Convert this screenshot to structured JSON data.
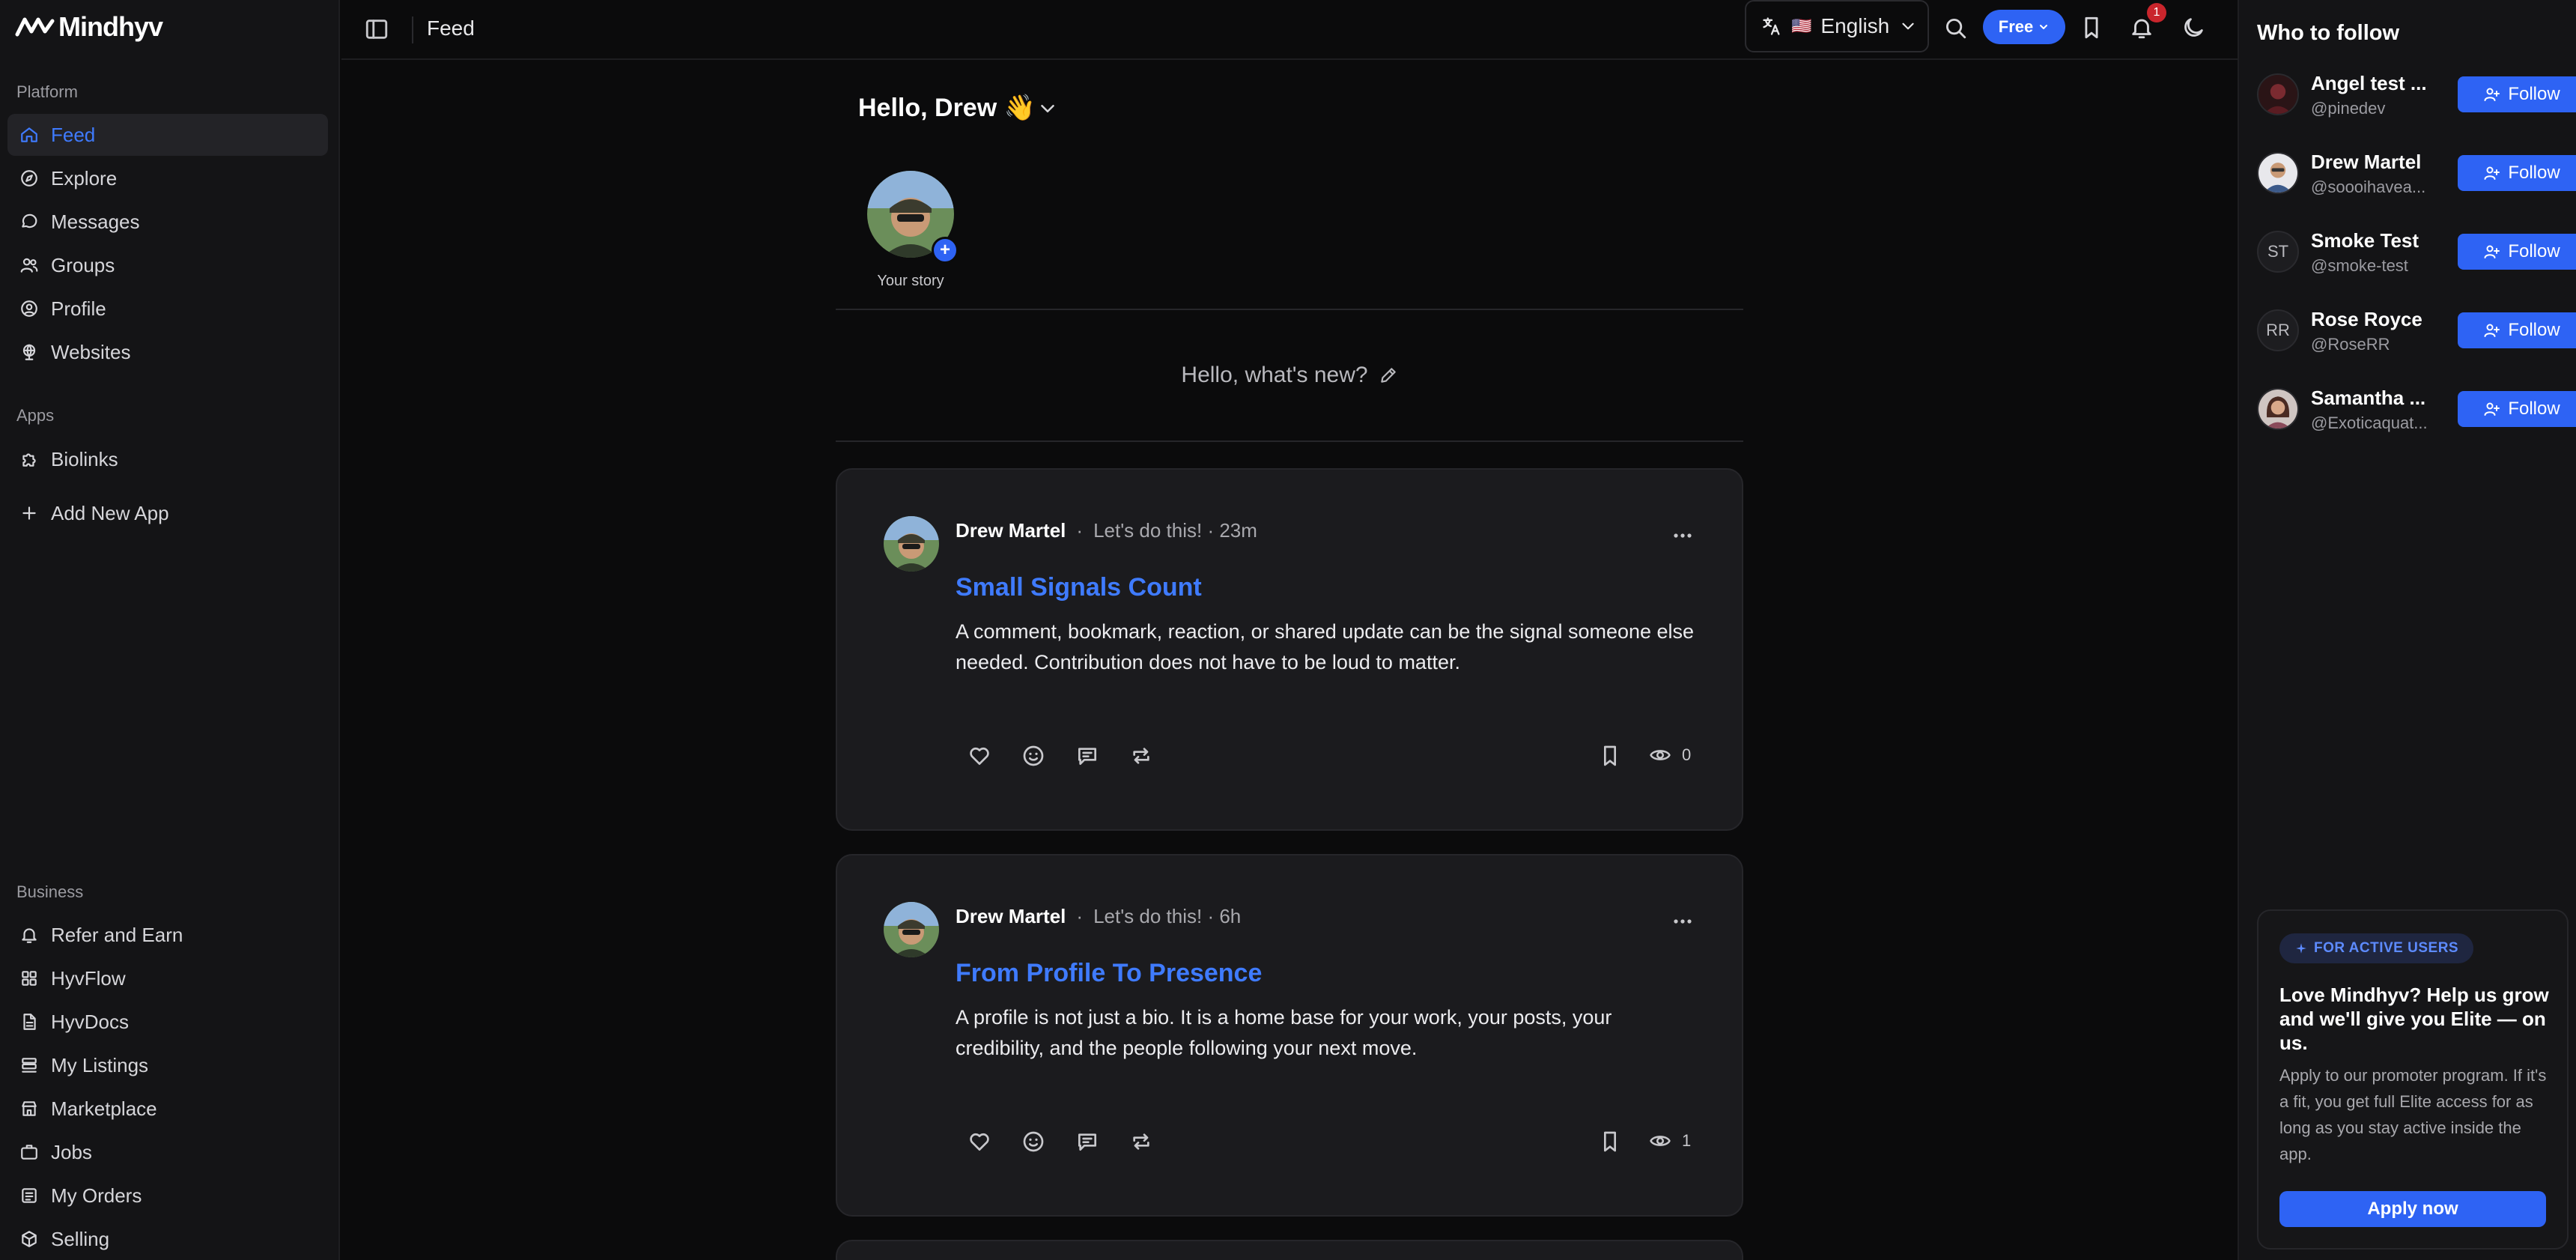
{
  "app": {
    "brand": "Mindhyv"
  },
  "sidebar": {
    "sections": {
      "platform": "Platform",
      "apps": "Apps",
      "business": "Business"
    },
    "platform_items": [
      {
        "label": "Feed",
        "icon": "home-icon",
        "active": true
      },
      {
        "label": "Explore",
        "icon": "compass-icon"
      },
      {
        "label": "Messages",
        "icon": "message-icon"
      },
      {
        "label": "Groups",
        "icon": "users-icon"
      },
      {
        "label": "Profile",
        "icon": "user-circle-icon"
      },
      {
        "label": "Websites",
        "icon": "globe-icon"
      }
    ],
    "apps_items": [
      {
        "label": "Biolinks",
        "icon": "puzzle-icon"
      },
      {
        "label": "Add New App",
        "icon": "plus-icon"
      }
    ],
    "business_items": [
      {
        "label": "Refer and Earn",
        "icon": "bell-icon"
      },
      {
        "label": "HyvFlow",
        "icon": "grid-icon"
      },
      {
        "label": "HyvDocs",
        "icon": "file-icon"
      },
      {
        "label": "My Listings",
        "icon": "list-icon"
      },
      {
        "label": "Marketplace",
        "icon": "store-icon"
      },
      {
        "label": "Jobs",
        "icon": "briefcase-icon"
      },
      {
        "label": "My Orders",
        "icon": "orders-icon"
      },
      {
        "label": "Selling",
        "icon": "package-icon"
      }
    ]
  },
  "topbar": {
    "breadcrumb": "Feed",
    "language": "English",
    "language_flag": "🇺🇸",
    "plan": "Free",
    "notification_count": "1"
  },
  "feed": {
    "greeting": "Hello, Drew 👋",
    "story_label": "Your story",
    "story_add": "+",
    "composer_prompt": "Hello, what's new?",
    "posts": [
      {
        "author": "Drew Martel",
        "separator": "·",
        "status": "Let's do this! · 23m",
        "title": "Small Signals Count",
        "body": "A comment, bookmark, reaction, or shared update can be the signal someone else needed. Contribution does not have to be loud to matter.",
        "views": "0"
      },
      {
        "author": "Drew Martel",
        "separator": "·",
        "status": "Let's do this! · 6h",
        "title": "From Profile To Presence",
        "body": "A profile is not just a bio. It is a home base for your work, your posts, your credibility, and the people following your next move.",
        "views": "1"
      }
    ]
  },
  "who_to_follow": {
    "title": "Who to follow",
    "follow_label": "Follow",
    "users": [
      {
        "name": "Angel test ...",
        "handle": "@pinedev",
        "initials": "",
        "avatar": "photo"
      },
      {
        "name": "Drew Martel",
        "handle": "@soooihavea...",
        "initials": "",
        "avatar": "photo"
      },
      {
        "name": "Smoke Test",
        "handle": "@smoke-test",
        "initials": "ST",
        "avatar": "initials"
      },
      {
        "name": "Rose Royce",
        "handle": "@RoseRR",
        "initials": "RR",
        "avatar": "initials"
      },
      {
        "name": "Samantha ...",
        "handle": "@Exoticaquat...",
        "initials": "",
        "avatar": "photo"
      }
    ]
  },
  "promo": {
    "badge": "FOR ACTIVE USERS",
    "title": "Love Mindhyv? Help us grow and we'll give you Elite — on us.",
    "description": "Apply to our promoter program. If it's a fit, you get full Elite access for as long as you stay active inside the app.",
    "cta": "Apply now"
  },
  "colors": {
    "accent": "#2e63f4",
    "link": "#3f7bff",
    "background": "#0b0b0c",
    "panel": "#141416",
    "card": "#1b1b1e",
    "badge": "#c9252c"
  }
}
